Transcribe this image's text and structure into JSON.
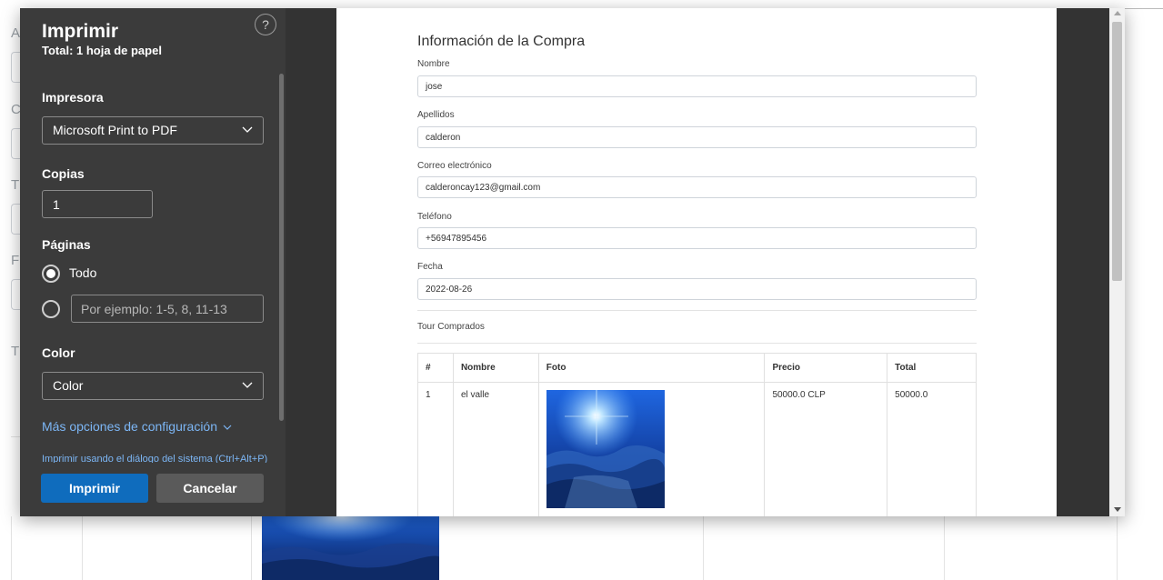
{
  "background": {
    "side_letters": [
      "A",
      "C",
      "T",
      "F",
      "T"
    ]
  },
  "panel": {
    "title": "Imprimir",
    "subtitle": "Total: 1 hoja de papel",
    "help_label": "?",
    "printer_label": "Impresora",
    "printer_value": "Microsoft Print to PDF",
    "copies_label": "Copias",
    "copies_value": "1",
    "pages_label": "Páginas",
    "pages_all_label": "Todo",
    "pages_custom_placeholder": "Por ejemplo: 1-5, 8, 11-13",
    "color_label": "Color",
    "color_value": "Color",
    "more_options_label": "Más opciones de configuración",
    "system_dialog_label": "Imprimir usando el diálogo del sistema (Ctrl+Alt+P)",
    "print_button": "Imprimir",
    "cancel_button": "Cancelar"
  },
  "document": {
    "title": "Información de la Compra",
    "fields": [
      {
        "label": "Nombre",
        "value": "jose"
      },
      {
        "label": "Apellidos",
        "value": "calderon"
      },
      {
        "label": "Correo electrónico",
        "value": "calderoncay123@gmail.com"
      },
      {
        "label": "Teléfono",
        "value": "+56947895456"
      },
      {
        "label": "Fecha",
        "value": "2022-08-26"
      }
    ],
    "tours_heading": "Tour Comprados",
    "table": {
      "headers": [
        "#",
        "Nombre",
        "Foto",
        "Precio",
        "Total"
      ],
      "rows": [
        {
          "num": "1",
          "nombre": "el valle",
          "precio": "50000.0 CLP",
          "total": "50000.0"
        }
      ]
    }
  },
  "colors": {
    "panel_bg": "#3b3b3b",
    "primary_button": "#0f6cbd",
    "link": "#7cb6f5",
    "preview_bg": "#333333"
  }
}
